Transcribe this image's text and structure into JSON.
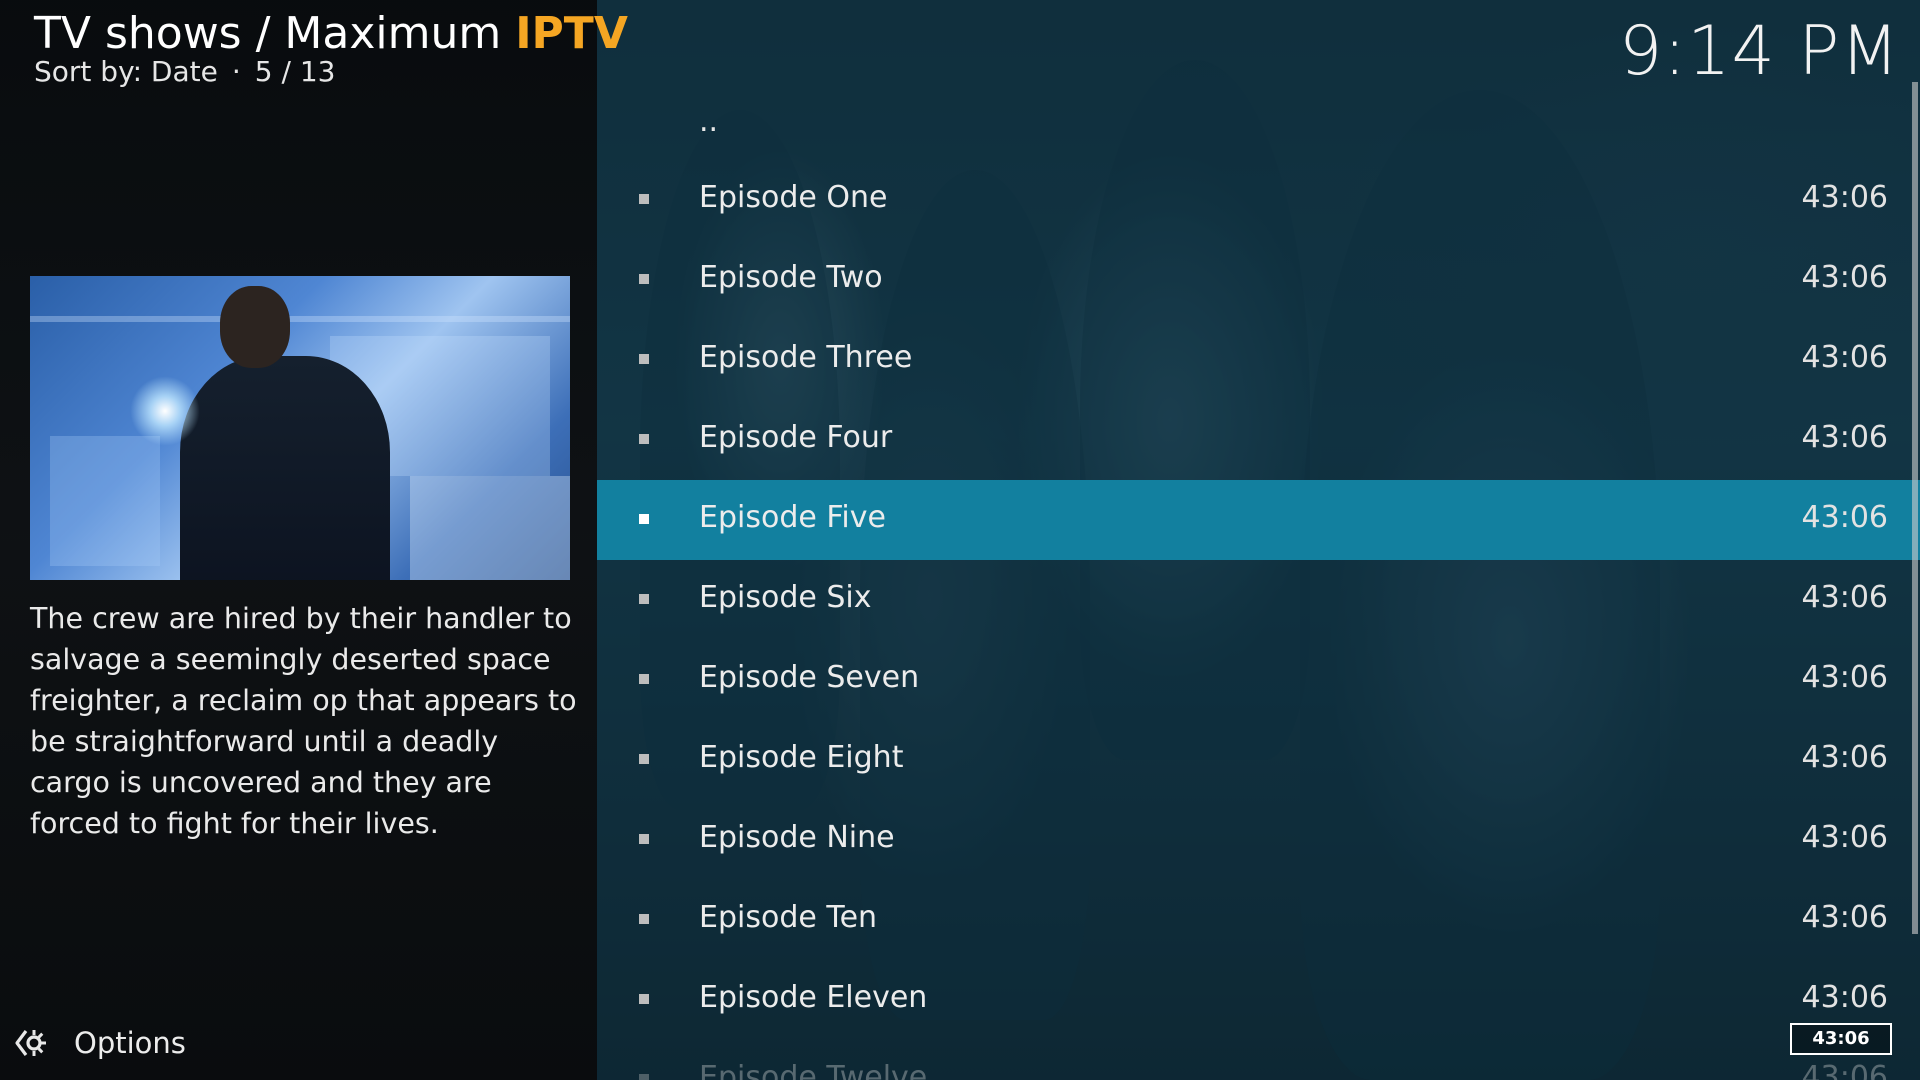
{
  "header": {
    "title_prefix": "TV shows / Maximum ",
    "title_accent": "IPTV",
    "sort_label": "Sort by: Date",
    "separator": "·",
    "position": "5 / 13",
    "accent_color": "#f5a623"
  },
  "clock": "9:14 PM",
  "info": {
    "plot": "The crew are hired by their handler to salvage a seemingly deserted space freighter, a reclaim op that appears to be straightforward until a deadly cargo is uncovered and they are forced to fight for their lives."
  },
  "options": {
    "label": "Options",
    "icon": "gear-icon"
  },
  "list": {
    "parent_label": "..",
    "selected_color": "#12809f",
    "items": [
      {
        "title": "Episode One",
        "duration": "43:06"
      },
      {
        "title": "Episode Two",
        "duration": "43:06"
      },
      {
        "title": "Episode Three",
        "duration": "43:06"
      },
      {
        "title": "Episode Four",
        "duration": "43:06"
      },
      {
        "title": "Episode Five",
        "duration": "43:06"
      },
      {
        "title": "Episode Six",
        "duration": "43:06"
      },
      {
        "title": "Episode Seven",
        "duration": "43:06"
      },
      {
        "title": "Episode Eight",
        "duration": "43:06"
      },
      {
        "title": "Episode Nine",
        "duration": "43:06"
      },
      {
        "title": "Episode Ten",
        "duration": "43:06"
      },
      {
        "title": "Episode Eleven",
        "duration": "43:06"
      },
      {
        "title": "Episode Twelve",
        "duration": "43:06"
      }
    ],
    "selected_index": 4
  },
  "runtime_badge": "43:06"
}
